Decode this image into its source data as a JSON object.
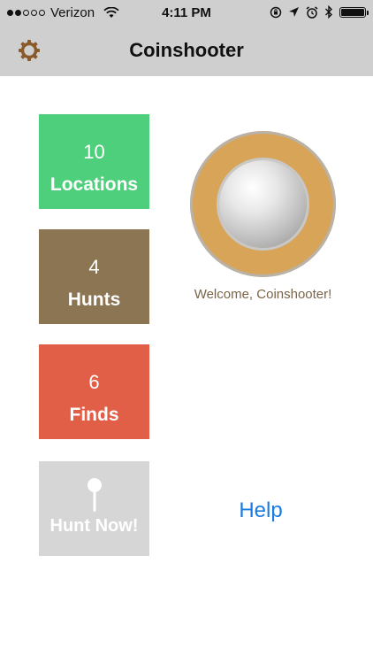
{
  "status_bar": {
    "carrier": "Verizon",
    "time": "4:11 PM",
    "signal_bars": [
      "on",
      "on",
      "off",
      "off",
      "off"
    ],
    "icons": [
      "wifi-icon",
      "lock-rotation-icon",
      "location-arrow-icon",
      "alarm-icon",
      "bluetooth-icon",
      "battery-icon"
    ]
  },
  "navbar": {
    "title": "Coinshooter",
    "settings_icon": "gear-icon",
    "accent": "#8a5a2b"
  },
  "tiles": [
    {
      "count": "10",
      "label": "Locations",
      "color": "#4dcf7b"
    },
    {
      "count": "4",
      "label": "Hunts",
      "color": "#8c7552"
    },
    {
      "count": "6",
      "label": "Finds",
      "color": "#e05f46"
    }
  ],
  "hunt_now": {
    "label": "Hunt Now!",
    "icon": "pin-icon",
    "color": "#d6d6d6"
  },
  "welcome": {
    "text": "Welcome, Coinshooter!"
  },
  "help": {
    "label": "Help",
    "color": "#1a7be0"
  }
}
